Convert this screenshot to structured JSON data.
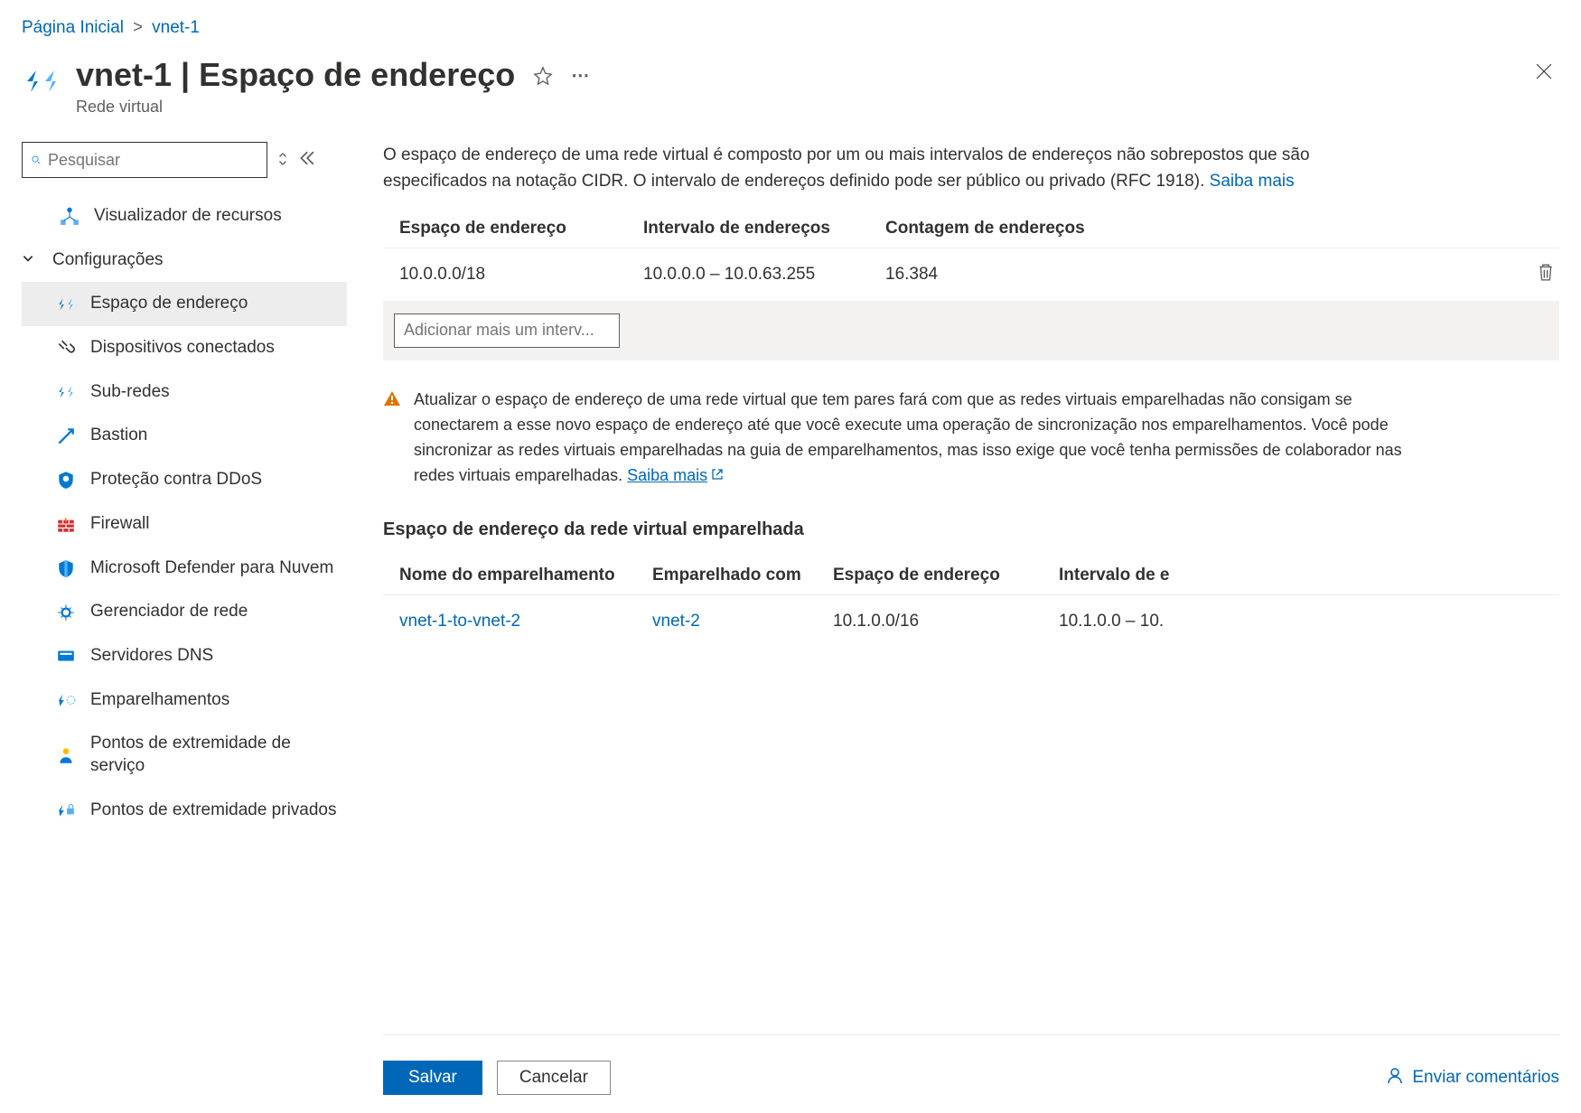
{
  "breadcrumb": {
    "home": "Página Inicial",
    "current": "vnet-1"
  },
  "header": {
    "title": "vnet-1 | Espaço de endereço",
    "subtitle": "Rede virtual"
  },
  "search": {
    "placeholder": "Pesquisar"
  },
  "sidebar": {
    "top_item": "Visualizador de recursos",
    "section": "Configurações",
    "items": [
      "Espaço de endereço",
      "Dispositivos conectados",
      "Sub-redes",
      "Bastion",
      "Proteção contra DDoS",
      "Firewall",
      "Microsoft Defender para Nuvem",
      "Gerenciador de rede",
      "Servidores DNS",
      "Emparelhamentos",
      "Pontos de extremidade de serviço",
      "Pontos de extremidade privados"
    ]
  },
  "content": {
    "description_1": "O espaço de endereço de uma rede virtual é composto por um ou mais intervalos de endereços não sobrepostos que são especificados na notação CIDR. O intervalo de endereços definido pode ser público ou privado (RFC 1918). ",
    "learn_more": "Saiba mais",
    "table": {
      "col_space": "Espaço de endereço",
      "col_range": "Intervalo de endereços",
      "col_count": "Contagem de endereços",
      "row": {
        "space": "10.0.0.0/18",
        "range": "10.0.0.0 – 10.0.63.255",
        "count": "16.384"
      },
      "add_placeholder": "Adicionar mais um interv..."
    },
    "warning": "Atualizar o espaço de endereço de uma rede virtual que tem pares fará com que as redes virtuais emparelhadas não consigam se conectarem a esse novo espaço de endereço até que você execute uma operação de sincronização nos emparelhamentos. Você pode sincronizar as redes virtuais emparelhadas na guia de emparelhamentos, mas isso exige que você tenha permissões de colaborador nas redes virtuais emparelhadas. ",
    "warning_link": "Saiba mais",
    "peer_section_title": "Espaço de endereço da rede virtual emparelhada",
    "peer_table": {
      "col_name": "Nome do emparelhamento",
      "col_with": "Emparelhado com",
      "col_space": "Espaço de endereço",
      "col_range": "Intervalo de e",
      "row": {
        "name": "vnet-1-to-vnet-2",
        "with": "vnet-2",
        "space": "10.1.0.0/16",
        "range": "10.1.0.0 – 10."
      }
    }
  },
  "footer": {
    "save": "Salvar",
    "cancel": "Cancelar",
    "feedback": "Enviar comentários"
  }
}
